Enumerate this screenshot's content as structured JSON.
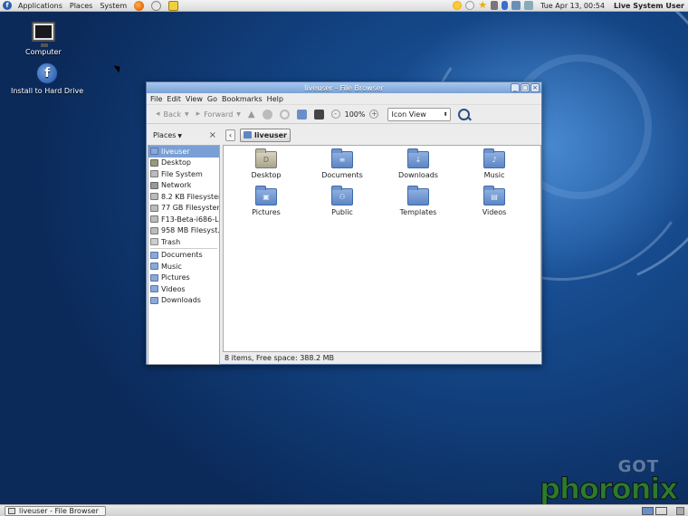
{
  "top_panel": {
    "menus": [
      "Applications",
      "Places",
      "System"
    ],
    "clock": "Tue Apr 13, 00:54",
    "user": "Live System User"
  },
  "desktop": {
    "icons": [
      {
        "label": "Computer"
      },
      {
        "label": "Install to Hard Drive"
      }
    ]
  },
  "window": {
    "title": "liveuser - File Browser",
    "menubar": [
      "File",
      "Edit",
      "View",
      "Go",
      "Bookmarks",
      "Help"
    ],
    "toolbar": {
      "back": "Back",
      "forward": "Forward",
      "zoom": "100%",
      "view_mode": "Icon View"
    },
    "sidebar_header": "Places",
    "pathbar_crumb": "liveuser",
    "places": [
      {
        "label": "liveuser",
        "icon": "home-folder",
        "selected": true
      },
      {
        "label": "Desktop",
        "icon": "desktop"
      },
      {
        "label": "File System",
        "icon": "drive"
      },
      {
        "label": "Network",
        "icon": "network"
      },
      {
        "label": "8.2 KB Filesystem",
        "icon": "drive"
      },
      {
        "label": "77 GB Filesystem",
        "icon": "drive"
      },
      {
        "label": "F13-Beta-i686-Li",
        "icon": "drive"
      },
      {
        "label": "958 MB Filesyst...",
        "icon": "drive"
      },
      {
        "label": "Trash",
        "icon": "trash"
      }
    ],
    "bookmarks": [
      {
        "label": "Documents"
      },
      {
        "label": "Music"
      },
      {
        "label": "Pictures"
      },
      {
        "label": "Videos"
      },
      {
        "label": "Downloads"
      }
    ],
    "files": [
      {
        "label": "Desktop",
        "emblem": "D"
      },
      {
        "label": "Documents",
        "emblem": "≡"
      },
      {
        "label": "Downloads",
        "emblem": "↓"
      },
      {
        "label": "Music",
        "emblem": "♪"
      },
      {
        "label": "Pictures",
        "emblem": "▣"
      },
      {
        "label": "Public",
        "emblem": "⚇"
      },
      {
        "label": "Templates",
        "emblem": ""
      },
      {
        "label": "Videos",
        "emblem": "▤"
      }
    ],
    "status": "8 items, Free space: 388.2 MB"
  },
  "bottom_panel": {
    "task": "liveuser - File Browser"
  },
  "watermark": {
    "small": "GOT",
    "big": "phoronix"
  }
}
